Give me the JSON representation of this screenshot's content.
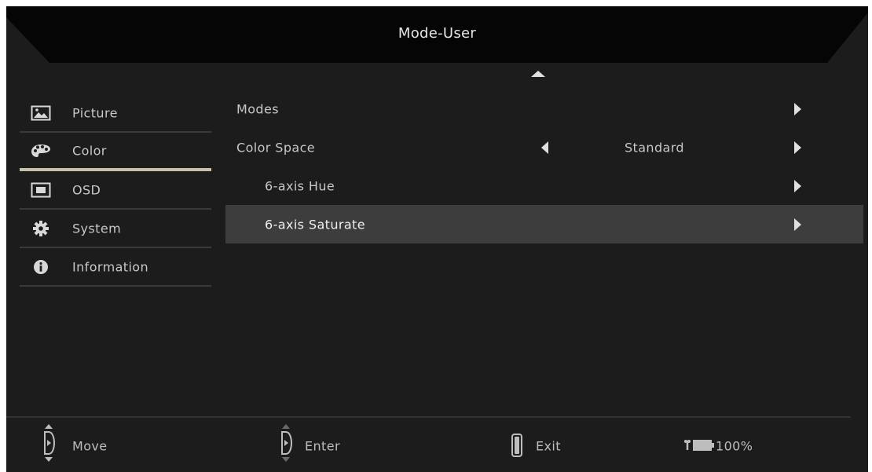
{
  "header": {
    "title": "Mode-User"
  },
  "sidebar": {
    "items": [
      {
        "label": "Picture",
        "icon": "picture-icon"
      },
      {
        "label": "Color",
        "icon": "palette-icon"
      },
      {
        "label": "OSD",
        "icon": "osd-icon"
      },
      {
        "label": "System",
        "icon": "gear-icon"
      },
      {
        "label": "Information",
        "icon": "info-icon"
      }
    ],
    "active": "Color"
  },
  "menu": {
    "rows": [
      {
        "label": "Modes"
      },
      {
        "label": "Color Space",
        "value": "Standard"
      },
      {
        "label": "6-axis Hue"
      },
      {
        "label": "6-axis Saturate"
      }
    ],
    "selected": "6-axis Saturate"
  },
  "footer": {
    "move_label": "Move",
    "enter_label": "Enter",
    "exit_label": "Exit",
    "battery_label": "100%"
  },
  "colors": {
    "background": "#1c1c1c",
    "header": "#050505",
    "selected_row": "#3d3d3d",
    "active_underline": "#c8c0a8",
    "text": "#c8c8c8"
  }
}
